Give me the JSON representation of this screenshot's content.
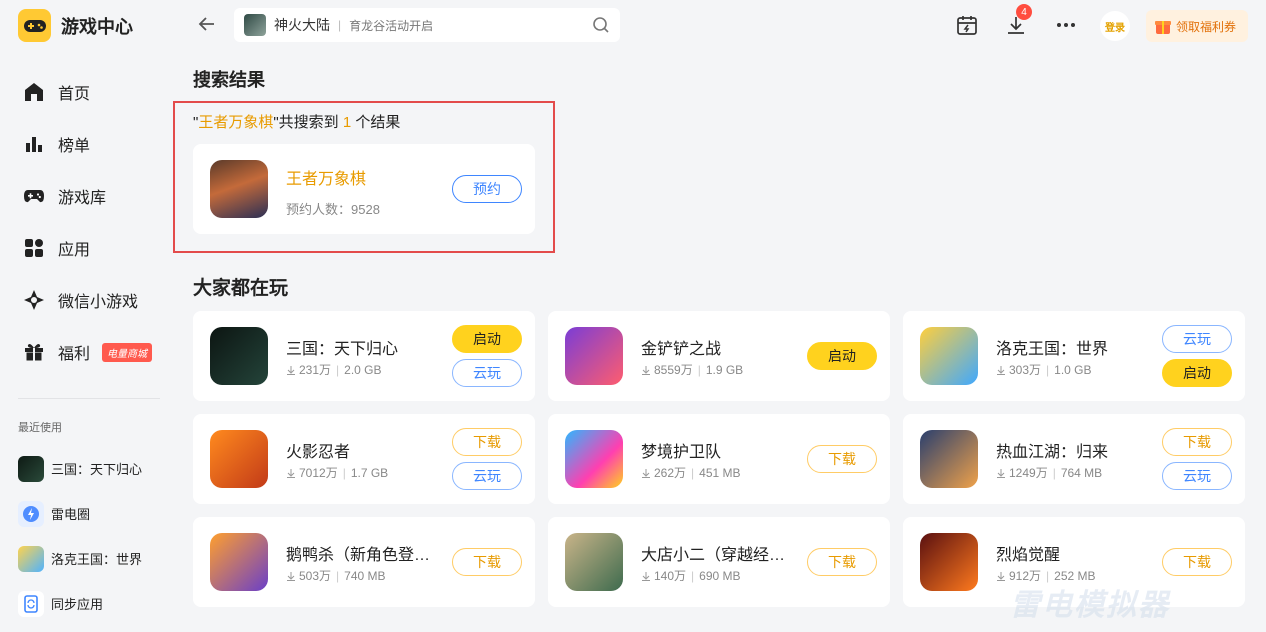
{
  "app": {
    "title": "游戏中心"
  },
  "sidebar": {
    "items": [
      {
        "label": "首页",
        "icon": "home-icon"
      },
      {
        "label": "榜单",
        "icon": "chart-icon"
      },
      {
        "label": "游戏库",
        "icon": "gamepad-icon"
      },
      {
        "label": "应用",
        "icon": "apps-icon"
      },
      {
        "label": "微信小游戏",
        "icon": "wechat-game-icon"
      },
      {
        "label": "福利",
        "icon": "gift-icon",
        "badge": "电量商城"
      }
    ],
    "recent_title": "最近使用",
    "recent": [
      {
        "label": "三国：天下归心"
      },
      {
        "label": "雷电圈"
      },
      {
        "label": "洛克王国：世界"
      },
      {
        "label": "同步应用"
      }
    ]
  },
  "topbar": {
    "search_value": "神火大陆",
    "search_hint": "育龙谷活动开启",
    "download_badge": "4",
    "login_label": "登录",
    "welfare_label": "领取福利券"
  },
  "search_results": {
    "title": "搜索结果",
    "quote_open": "\"",
    "keyword": "王者万象棋",
    "quote_close": "\"",
    "text_mid": "共搜索到 ",
    "count": "1",
    "text_end": " 个结果",
    "item": {
      "name": "王者万象棋",
      "info": "预约人数：9528",
      "button": "预约"
    }
  },
  "popular": {
    "title": "大家都在玩",
    "games": [
      {
        "name": "三国：天下归心",
        "downloads": "231万",
        "size": "2.0 GB",
        "buttons": [
          "启动",
          "云玩"
        ]
      },
      {
        "name": "金铲铲之战",
        "downloads": "8559万",
        "size": "1.9 GB",
        "buttons": [
          "启动"
        ]
      },
      {
        "name": "洛克王国：世界",
        "downloads": "303万",
        "size": "1.0 GB",
        "buttons": [
          "云玩",
          "启动"
        ]
      },
      {
        "name": "火影忍者",
        "downloads": "7012万",
        "size": "1.7 GB",
        "buttons": [
          "下载",
          "云玩"
        ]
      },
      {
        "name": "梦境护卫队",
        "downloads": "262万",
        "size": "451 MB",
        "buttons": [
          "下载"
        ]
      },
      {
        "name": "热血江湖：归来",
        "downloads": "1249万",
        "size": "764 MB",
        "buttons": [
          "下载",
          "云玩"
        ]
      },
      {
        "name": "鹅鸭杀（新角色登场）",
        "downloads": "503万",
        "size": "740 MB",
        "buttons": [
          "下载"
        ]
      },
      {
        "name": "大店小二（穿越经营）",
        "downloads": "140万",
        "size": "690 MB",
        "buttons": [
          "下载"
        ]
      },
      {
        "name": "烈焰觉醒",
        "downloads": "912万",
        "size": "252 MB",
        "buttons": [
          "下载"
        ]
      }
    ]
  },
  "watermark": "雷电模拟器",
  "colors": {
    "accent": "#ffd21e",
    "highlight": "#e89b00",
    "cloud_blue": "#3f86ff",
    "result_border": "#e34b4b"
  }
}
